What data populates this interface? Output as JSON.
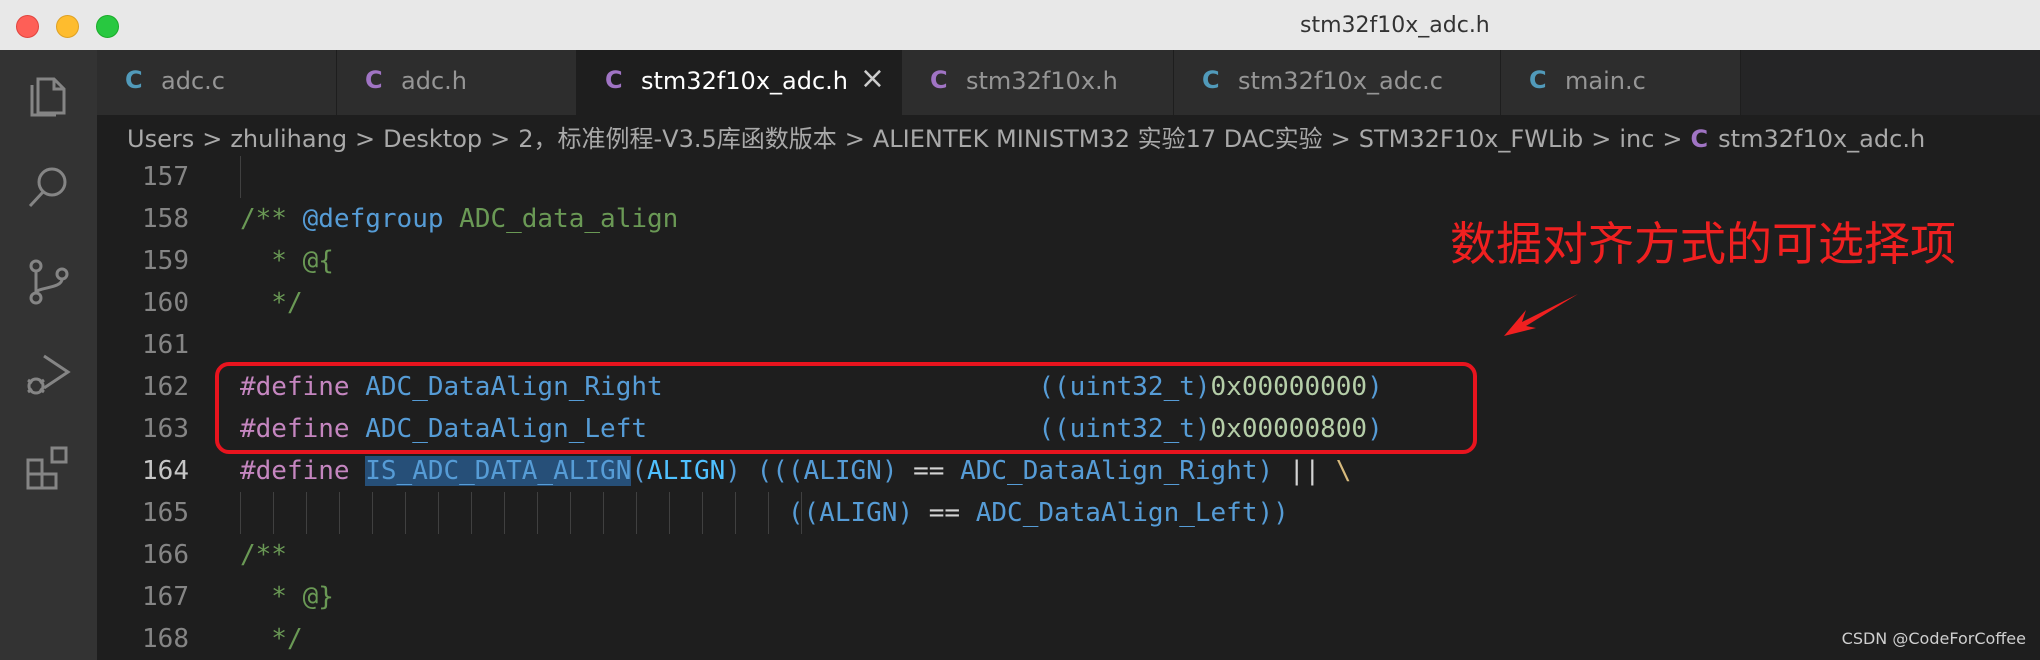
{
  "window": {
    "title": "stm32f10x_adc.h"
  },
  "activity_bar": {
    "items": [
      {
        "icon": "files-icon"
      },
      {
        "icon": "search-icon"
      },
      {
        "icon": "source-control-icon"
      },
      {
        "icon": "run-debug-icon"
      },
      {
        "icon": "extensions-icon"
      }
    ]
  },
  "tabs": [
    {
      "icon": "C",
      "icon_color": "#519aba",
      "label": "adc.c",
      "active": false
    },
    {
      "icon": "C",
      "icon_color": "#a074c4",
      "label": "adc.h",
      "active": false
    },
    {
      "icon": "C",
      "icon_color": "#a074c4",
      "label": "stm32f10x_adc.h",
      "active": true,
      "close": "×"
    },
    {
      "icon": "C",
      "icon_color": "#a074c4",
      "label": "stm32f10x.h",
      "active": false
    },
    {
      "icon": "C",
      "icon_color": "#519aba",
      "label": "stm32f10x_adc.c",
      "active": false
    },
    {
      "icon": "C",
      "icon_color": "#519aba",
      "label": "main.c",
      "active": false
    }
  ],
  "breadcrumb": {
    "items": [
      "Users",
      "zhulihang",
      "Desktop",
      "2，标准例程-V3.5库函数版本",
      "ALIENTEK MINISTM32 实验17 DAC实验",
      "STM32F10x_FWLib",
      "inc"
    ],
    "file_icon": "C",
    "file": "stm32f10x_adc.h",
    "separator": ">"
  },
  "editor": {
    "current_line": 164,
    "lines": [
      {
        "n": "157",
        "text": ""
      },
      {
        "n": "158",
        "text": "/** @defgroup ADC_data_align"
      },
      {
        "n": "159",
        "text": "  * @{"
      },
      {
        "n": "160",
        "text": "  */"
      },
      {
        "n": "161",
        "text": ""
      },
      {
        "n": "162",
        "text": "#define ADC_DataAlign_Right                        ((uint32_t)0x00000000)"
      },
      {
        "n": "163",
        "text": "#define ADC_DataAlign_Left                         ((uint32_t)0x00000800)"
      },
      {
        "n": "164",
        "text": "#define IS_ADC_DATA_ALIGN(ALIGN) (((ALIGN) == ADC_DataAlign_Right) || \\"
      },
      {
        "n": "165",
        "text": "                                   ((ALIGN) == ADC_DataAlign_Left))"
      },
      {
        "n": "166",
        "text": "/**"
      },
      {
        "n": "167",
        "text": "  * @}"
      },
      {
        "n": "168",
        "text": "  */"
      }
    ]
  },
  "annotation": {
    "text": "数据对齐方式的可选择项",
    "color": "#f02020"
  },
  "watermark": "CSDN @CodeForCoffee",
  "colors": {
    "editor_bg": "#1e1e1e",
    "activity_bg": "#333333",
    "tab_inactive_bg": "#2d2d2d",
    "comment": "#6a9955",
    "keyword": "#569cd6",
    "preprocessor": "#c586c0",
    "number": "#b5cea8",
    "highlight_box": "#e8141e"
  }
}
